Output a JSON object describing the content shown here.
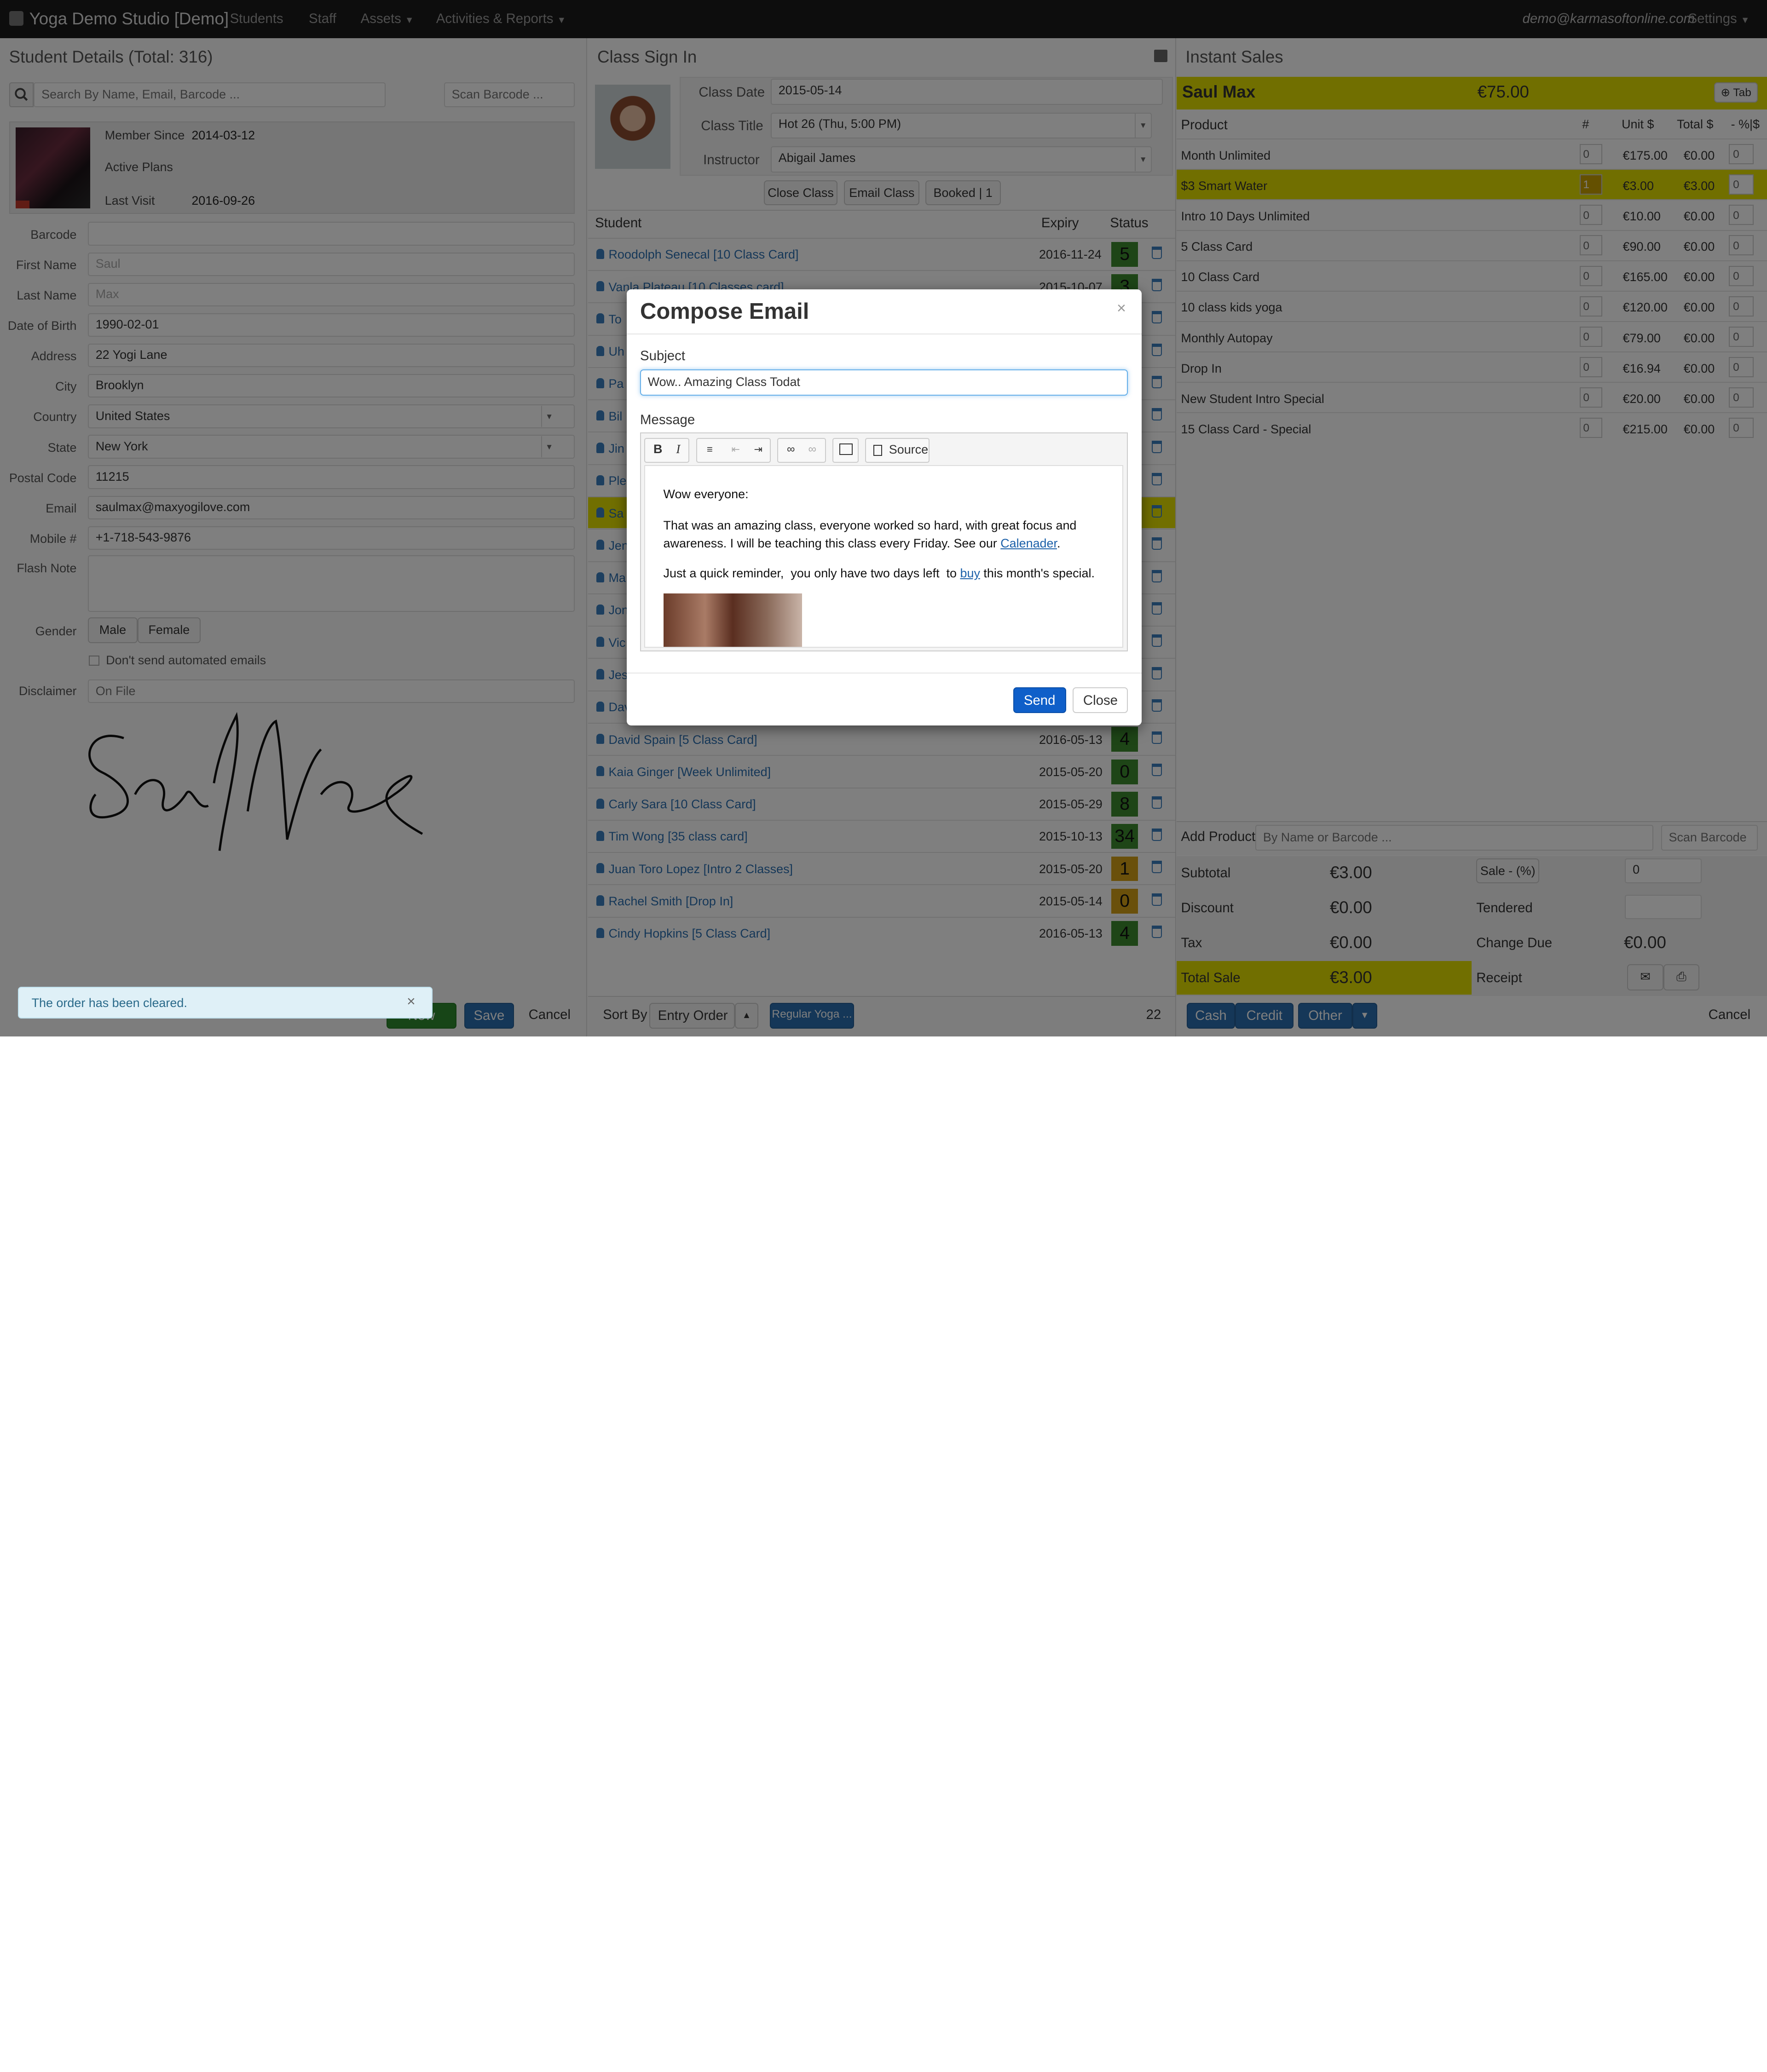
{
  "nav": {
    "brand": "Yoga Demo Studio [Demo]",
    "items": [
      "Students",
      "Staff",
      "Assets",
      "Activities & Reports"
    ],
    "user": "demo@karmasoftonline.com",
    "settings": "Settings"
  },
  "student": {
    "title": "Student Details (Total: 316)",
    "search_placeholder": "Search By Name, Email, Barcode ...",
    "scan_placeholder": "Scan Barcode ...",
    "member_since_label": "Member Since",
    "member_since": "2014-03-12",
    "active_plans": "Active Plans",
    "last_visit_label": "Last Visit",
    "last_visit": "2016-09-26",
    "fields": [
      {
        "label": "Barcode",
        "value": "",
        "placeholder": ""
      },
      {
        "label": "First Name",
        "value": "",
        "placeholder": "Saul"
      },
      {
        "label": "Last Name",
        "value": "",
        "placeholder": "Max"
      },
      {
        "label": "Date of Birth",
        "value": "1990-02-01",
        "placeholder": ""
      },
      {
        "label": "Address",
        "value": "22 Yogi Lane",
        "placeholder": ""
      },
      {
        "label": "City",
        "value": "Brooklyn",
        "placeholder": ""
      },
      {
        "label": "Country",
        "value": "United States",
        "placeholder": ""
      },
      {
        "label": "State",
        "value": "New York",
        "placeholder": ""
      },
      {
        "label": "Postal Code",
        "value": "11215",
        "placeholder": ""
      },
      {
        "label": "Email",
        "value": "saulmax@maxyogilove.com",
        "placeholder": ""
      },
      {
        "label": "Mobile #",
        "value": "+1-718-543-9876",
        "placeholder": ""
      }
    ],
    "flash_note_label": "Flash Note",
    "gender_label": "Gender",
    "gender_male": "Male",
    "gender_female": "Female",
    "no_auto_emails": "Don't send automated emails",
    "disclaimer_label": "Disclaimer",
    "disclaimer_placeholder": "On File",
    "toast": "The order has been cleared.",
    "new_btn": "New",
    "save_btn": "Save",
    "cancel_btn": "Cancel"
  },
  "signin": {
    "title": "Class Sign In",
    "class_date_label": "Class Date",
    "class_date": "2015-05-14",
    "class_title_label": "Class Title",
    "class_title": "Hot 26 (Thu, 5:00 PM)",
    "instructor_label": "Instructor",
    "instructor": "Abigail James",
    "close_class": "Close Class",
    "email_class": "Email Class",
    "booked": "Booked | 1",
    "headers": {
      "student": "Student",
      "expiry": "Expiry",
      "status": "Status"
    },
    "rows": [
      {
        "name": "Roodolph Senecal [10 Class Card]",
        "expiry": "2016-11-24",
        "status": "5",
        "color": "#3c8a2e"
      },
      {
        "name": "Vanla Plateau [10 Classes card]",
        "expiry": "2015-10-07",
        "status": "3",
        "color": "#3c8a2e"
      },
      {
        "name": "To",
        "expiry": "",
        "status": "",
        "color": ""
      },
      {
        "name": "Uh",
        "expiry": "",
        "status": "",
        "color": ""
      },
      {
        "name": "Pa",
        "expiry": "",
        "status": "",
        "color": ""
      },
      {
        "name": "Bil",
        "expiry": "",
        "status": "",
        "color": ""
      },
      {
        "name": "Jin",
        "expiry": "",
        "status": "",
        "color": ""
      },
      {
        "name": "Ple",
        "expiry": "",
        "status": "",
        "color": ""
      },
      {
        "name": "Sa",
        "expiry": "",
        "status": "",
        "color": ""
      },
      {
        "name": "Jen",
        "expiry": "",
        "status": "",
        "color": ""
      },
      {
        "name": "Ma",
        "expiry": "",
        "status": "",
        "color": ""
      },
      {
        "name": "Jon",
        "expiry": "",
        "status": "",
        "color": ""
      },
      {
        "name": "Vic",
        "expiry": "",
        "status": "",
        "color": ""
      },
      {
        "name": "Jes",
        "expiry": "",
        "status": "",
        "color": ""
      },
      {
        "name": "Dav",
        "expiry": "",
        "status": "",
        "color": ""
      },
      {
        "name": "David Spain [5 Class Card]",
        "expiry": "2016-05-13",
        "status": "4",
        "color": "#3c8a2e"
      },
      {
        "name": "Kaia Ginger [Week Unlimited]",
        "expiry": "2015-05-20",
        "status": "0",
        "color": "#3c8a2e"
      },
      {
        "name": "Carly Sara [10 Class Card]",
        "expiry": "2015-05-29",
        "status": "8",
        "color": "#3c8a2e"
      },
      {
        "name": "Tim Wong [35 class card]",
        "expiry": "2015-10-13",
        "status": "34",
        "color": "#3c8a2e"
      },
      {
        "name": "Juan Toro Lopez [Intro 2 Classes]",
        "expiry": "2015-05-20",
        "status": "1",
        "color": "#d4a017"
      },
      {
        "name": "Rachel Smith [Drop In]",
        "expiry": "2015-05-14",
        "status": "0",
        "color": "#d4a017"
      },
      {
        "name": "Cindy Hopkins [5 Class Card]",
        "expiry": "2016-05-13",
        "status": "4",
        "color": "#3c8a2e"
      }
    ],
    "sort_label": "Sort By",
    "sort_value": "Entry Order",
    "filter_btn": "Regular Yoga ...",
    "count": "22"
  },
  "sales": {
    "title": "Instant Sales",
    "customer": "Saul Max",
    "balance": "€75.00",
    "tab_btn": "Tab",
    "headers": {
      "product": "Product",
      "qty": "#",
      "unit": "Unit $",
      "total": "Total $",
      "disc": "- %|$"
    },
    "products": [
      {
        "name": "Month Unlimited",
        "qty": "0",
        "unit": "€175.00",
        "total": "€0.00",
        "disc": "0"
      },
      {
        "name": "$3 Smart Water",
        "qty": "1",
        "unit": "€3.00",
        "total": "€3.00",
        "disc": "0"
      },
      {
        "name": "Intro 10 Days Unlimited",
        "qty": "0",
        "unit": "€10.00",
        "total": "€0.00",
        "disc": "0"
      },
      {
        "name": "5 Class Card",
        "qty": "0",
        "unit": "€90.00",
        "total": "€0.00",
        "disc": "0"
      },
      {
        "name": "10 Class Card",
        "qty": "0",
        "unit": "€165.00",
        "total": "€0.00",
        "disc": "0"
      },
      {
        "name": "10 class kids yoga",
        "qty": "0",
        "unit": "€120.00",
        "total": "€0.00",
        "disc": "0"
      },
      {
        "name": "Monthly Autopay",
        "qty": "0",
        "unit": "€79.00",
        "total": "€0.00",
        "disc": "0"
      },
      {
        "name": "Drop In",
        "qty": "0",
        "unit": "€16.94",
        "total": "€0.00",
        "disc": "0"
      },
      {
        "name": "New Student Intro Special",
        "qty": "0",
        "unit": "€20.00",
        "total": "€0.00",
        "disc": "0"
      },
      {
        "name": "15 Class Card - Special",
        "qty": "0",
        "unit": "€215.00",
        "total": "€0.00",
        "disc": "0"
      }
    ],
    "add_product_label": "Add Product",
    "add_product_placeholder": "By Name or Barcode ...",
    "scan_placeholder": "Scan Barcode ...",
    "subtotal_label": "Subtotal",
    "subtotal": "€3.00",
    "discount_label": "Discount",
    "discount": "€0.00",
    "tax_label": "Tax",
    "tax": "€0.00",
    "total_label": "Total Sale",
    "total": "€3.00",
    "sale_pct_btn": "Sale - (%)",
    "sale_pct_value": "0",
    "tendered_label": "Tendered",
    "change_label": "Change Due",
    "change": "€0.00",
    "receipt_label": "Receipt",
    "cash": "Cash",
    "credit": "Credit",
    "other": "Other",
    "cancel": "Cancel"
  },
  "modal": {
    "title": "Compose Email",
    "subject_label": "Subject",
    "subject": "Wow.. Amazing Class Todat",
    "message_label": "Message",
    "source_btn": "Source",
    "body_greeting": "Wow everyone:",
    "body_p1_a": "That was an amazing class, everyone worked so hard, with great focus and awareness. I will be teaching this class every Friday. See our ",
    "body_p1_link": "Calenader",
    "body_p1_b": ".",
    "body_p2_a": "Just a quick reminder,  you only have two days left  to ",
    "body_p2_link": "buy",
    "body_p2_b": " this month's special.",
    "send": "Send",
    "close": "Close"
  }
}
